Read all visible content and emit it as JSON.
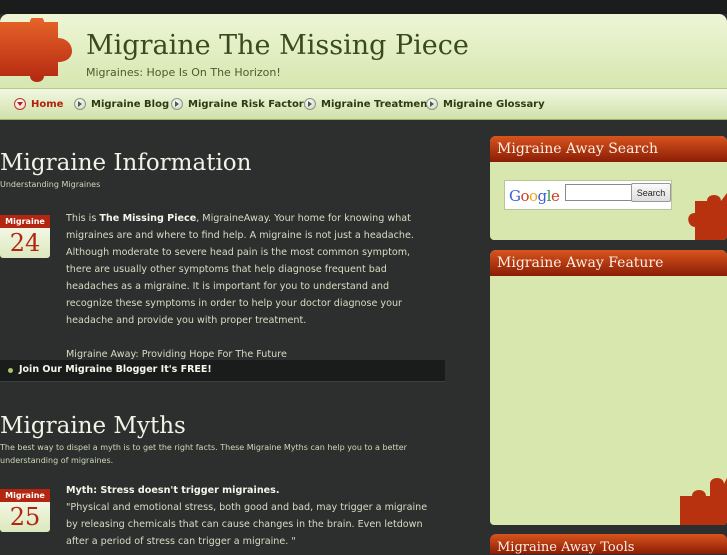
{
  "header": {
    "title": "Migraine The Missing Piece",
    "tagline": "Migraines: Hope Is On The Horizon!"
  },
  "nav": {
    "items": [
      {
        "label": "Home",
        "active": true
      },
      {
        "label": "Migraine Blog"
      },
      {
        "label": "Migraine Risk Factors"
      },
      {
        "label": "Migraine Treatment"
      },
      {
        "label": "Migraine Glossary"
      }
    ]
  },
  "posts": [
    {
      "title": "Migraine Information",
      "subtitle": "Understanding Migraines",
      "date_label": "Migraine",
      "date_day": "24",
      "body_intro": "This is ",
      "body_bold": "The Missing Piece",
      "body_rest": ", MigraineAway. Your home for knowing what migraines are and where to find help. A migraine is not just a headache. Although moderate to severe head pain is the most common symptom, there are usually other symptoms that help diagnose frequent bad headaches as a migraine. It is important for you to understand and recognize these symptoms in order to help your doctor diagnose your headache and provide you with proper treatment.",
      "body_footer": "Migraine Away: Providing Hope For The Future"
    },
    {
      "title": "Migraine Myths",
      "subtitle": "The best way to dispel a myth is to get the right facts. These Migraine Myths can help you to a better understanding of migraines.",
      "date_label": "Migraine",
      "date_day": "25",
      "myth_heading": "Myth: Stress doesn't trigger migraines.",
      "myth_text": "\"Physical and emotional stress, both good and bad, may trigger a migraine by releasing chemicals that can cause changes in the brain. Even letdown after a period of stress can trigger a migraine. \""
    }
  ],
  "join_bar": {
    "label": "Join Our Migraine Blogger It's FREE!"
  },
  "sidebar": {
    "search_widget": {
      "title": "Migraine Away Search",
      "logo_text": "Google",
      "input_value": "",
      "button_label": "Search"
    },
    "feature_widget": {
      "title": "Migraine Away Feature"
    },
    "third_widget": {
      "title": "Migraine Away Tools"
    }
  },
  "colors": {
    "background": "#2c2f2e",
    "header_green": "#d6e7b0",
    "accent_red": "#b3260f",
    "widget_body": "#d7e7ad"
  }
}
